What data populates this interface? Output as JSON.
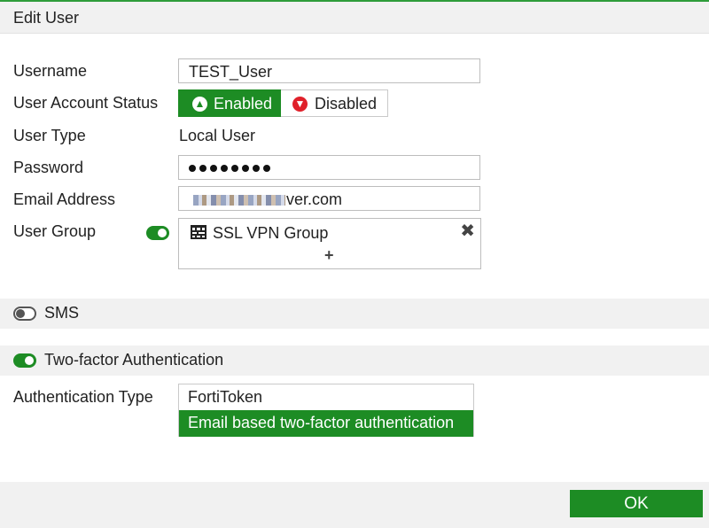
{
  "dialog": {
    "title": "Edit User"
  },
  "form": {
    "username": {
      "label": "Username",
      "value": "TEST_User"
    },
    "status": {
      "label": "User Account Status",
      "enabled_label": "Enabled",
      "disabled_label": "Disabled",
      "selected": "Enabled"
    },
    "user_type": {
      "label": "User Type",
      "value": "Local User"
    },
    "password": {
      "label": "Password",
      "masked_length": 8
    },
    "email": {
      "label": "Email Address",
      "value_visible_suffix": "ver.com"
    },
    "user_group": {
      "label": "User Group",
      "toggle_on": true,
      "groups": [
        "SSL VPN Group"
      ],
      "remove_symbol": "✖",
      "add_symbol": "+"
    }
  },
  "sections": {
    "sms": {
      "label": "SMS",
      "toggle_on": false
    },
    "two_factor": {
      "label": "Two-factor Authentication",
      "toggle_on": true
    }
  },
  "auth_type": {
    "label": "Authentication Type",
    "options": [
      "FortiToken",
      "Email based two-factor authentication"
    ],
    "selected": "Email based two-factor authentication"
  },
  "footer": {
    "ok_label": "OK"
  },
  "colors": {
    "accent": "#1d8c24",
    "danger": "#e0202a",
    "header_bg": "#f1f1f1"
  }
}
